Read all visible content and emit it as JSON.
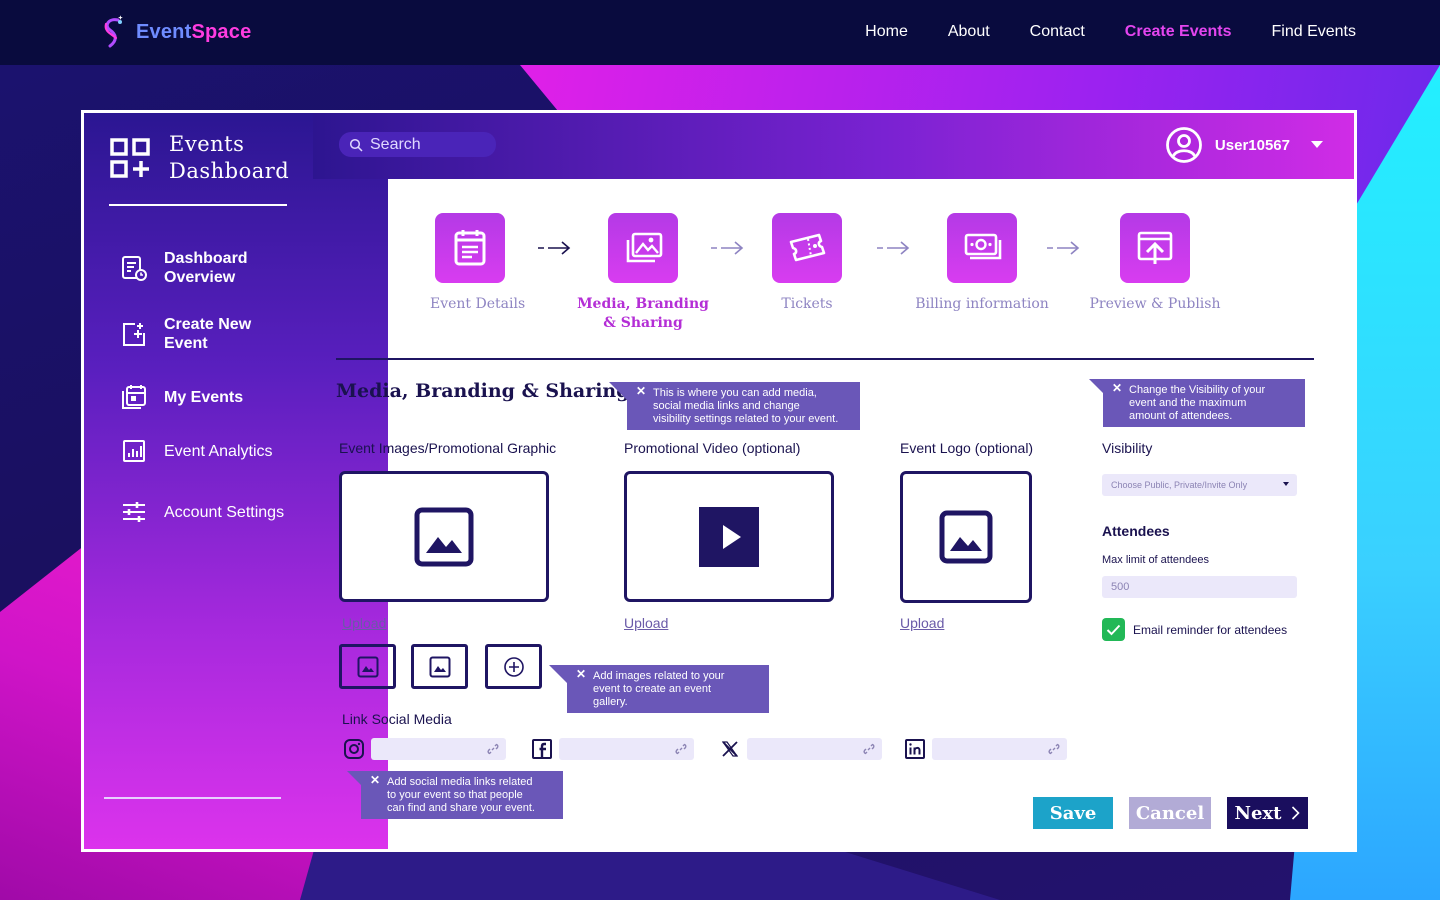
{
  "brand": {
    "word1": "Event",
    "word2": "Space"
  },
  "nav": [
    {
      "label": "Home",
      "active": false
    },
    {
      "label": "About",
      "active": false
    },
    {
      "label": "Contact",
      "active": false
    },
    {
      "label": "Create Events",
      "active": true
    },
    {
      "label": "Find Events",
      "active": false
    }
  ],
  "sidebar": {
    "title_line1": "Events",
    "title_line2": "Dashboard",
    "items": [
      {
        "line1": "Dashboard",
        "line2": "Overview",
        "icon": "dashboard-report-icon"
      },
      {
        "line1": "Create New",
        "line2": "Event",
        "icon": "add-square-icon"
      },
      {
        "line1": "My Events",
        "line2": "",
        "icon": "calendar-stack-icon"
      },
      {
        "line1": "Event Analytics",
        "line2": "",
        "icon": "analytics-icon"
      },
      {
        "line1": "Account Settings",
        "line2": "",
        "icon": "sliders-icon"
      }
    ]
  },
  "header": {
    "search_placeholder": "Search",
    "username": "User10567"
  },
  "steps": [
    {
      "line1": "Event Details",
      "line2": "",
      "icon": "form-icon",
      "active": false
    },
    {
      "line1": "Media, Branding",
      "line2": "& Sharing",
      "icon": "gallery-icon",
      "active": true
    },
    {
      "line1": "Tickets",
      "line2": "",
      "icon": "ticket-icon",
      "active": false
    },
    {
      "line1": "Billing information",
      "line2": "",
      "icon": "money-icon",
      "active": false
    },
    {
      "line1": "Preview & Publish",
      "line2": "",
      "icon": "upload-icon",
      "active": false
    }
  ],
  "section_title": "Media, Branding & Sharing",
  "tooltips": {
    "section": [
      "This is where you can add media,",
      "social media links and change",
      "visibility settings related to your event."
    ],
    "visibility": [
      "Change the Visibility of your",
      "event and the maximum",
      "amount of attendees."
    ],
    "gallery": [
      "Add images related to your",
      "event to create an event",
      "gallery."
    ],
    "social": [
      "Add social media links related",
      "to your event so that people",
      "can find and share your event."
    ]
  },
  "media": {
    "images_label": "Event Images/Promotional Graphic",
    "video_label": "Promotional  Video (optional)",
    "logo_label": "Event Logo (optional)",
    "upload": "Upload"
  },
  "social": {
    "label": "Link Social Media",
    "networks": [
      "instagram-icon",
      "facebook-icon",
      "x-icon",
      "linkedin-icon"
    ]
  },
  "right_panel": {
    "visibility_label": "Visibility",
    "visibility_placeholder": "Choose Public, Private/Invite Only",
    "attendees_label": "Attendees",
    "max_label": "Max limit of attendees",
    "max_value": "500",
    "email_reminder": "Email reminder for attendees"
  },
  "buttons": {
    "save": "Save",
    "cancel": "Cancel",
    "next": "Next"
  },
  "colors": {
    "accent": "#e445ef",
    "dark": "#1a0e5e",
    "save": "#1ca3c9",
    "cancel": "#b2abd6",
    "tooltip": "#6a57b8"
  }
}
